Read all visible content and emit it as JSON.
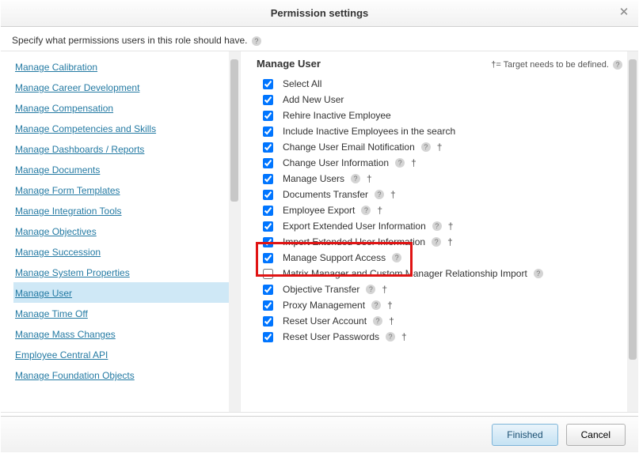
{
  "dialog": {
    "title": "Permission settings",
    "close_glyph": "✕",
    "instruction": "Specify what permissions users in this role should have."
  },
  "sidebar": {
    "selected_index": 11,
    "items": [
      "Manage Calibration",
      "Manage Career Development",
      "Manage Compensation",
      "Manage Competencies and Skills",
      "Manage Dashboards / Reports",
      "Manage Documents",
      "Manage Form Templates",
      "Manage Integration Tools",
      "Manage Objectives",
      "Manage Succession",
      "Manage System Properties",
      "Manage User",
      "Manage Time Off",
      "Manage Mass Changes",
      "Employee Central API",
      "Manage Foundation Objects"
    ]
  },
  "section": {
    "title": "Manage User",
    "target_note": "†= Target needs to be defined.",
    "highlighted_index": 11,
    "permissions": [
      {
        "label": "Select All",
        "checked": true,
        "help": false,
        "dagger": false
      },
      {
        "label": "Add New User",
        "checked": true,
        "help": false,
        "dagger": false
      },
      {
        "label": "Rehire Inactive Employee",
        "checked": true,
        "help": false,
        "dagger": false
      },
      {
        "label": "Include Inactive Employees in the search",
        "checked": true,
        "help": false,
        "dagger": false
      },
      {
        "label": "Change User Email Notification",
        "checked": true,
        "help": true,
        "dagger": true
      },
      {
        "label": "Change User Information",
        "checked": true,
        "help": true,
        "dagger": true
      },
      {
        "label": "Manage Users",
        "checked": true,
        "help": true,
        "dagger": true
      },
      {
        "label": "Documents Transfer",
        "checked": true,
        "help": true,
        "dagger": true
      },
      {
        "label": "Employee Export",
        "checked": true,
        "help": true,
        "dagger": true
      },
      {
        "label": "Export Extended User Information",
        "checked": true,
        "help": true,
        "dagger": true
      },
      {
        "label": "Import Extended User Information",
        "checked": true,
        "help": true,
        "dagger": true
      },
      {
        "label": "Manage Support Access",
        "checked": true,
        "help": true,
        "dagger": false
      },
      {
        "label": "Matrix Manager and Custom Manager Relationship Import",
        "checked": false,
        "help": true,
        "dagger": false
      },
      {
        "label": "Objective Transfer",
        "checked": true,
        "help": true,
        "dagger": true
      },
      {
        "label": "Proxy Management",
        "checked": true,
        "help": true,
        "dagger": true
      },
      {
        "label": "Reset User Account",
        "checked": true,
        "help": true,
        "dagger": true
      },
      {
        "label": "Reset User Passwords",
        "checked": true,
        "help": true,
        "dagger": true
      }
    ]
  },
  "footer": {
    "finished_label": "Finished",
    "cancel_label": "Cancel"
  }
}
